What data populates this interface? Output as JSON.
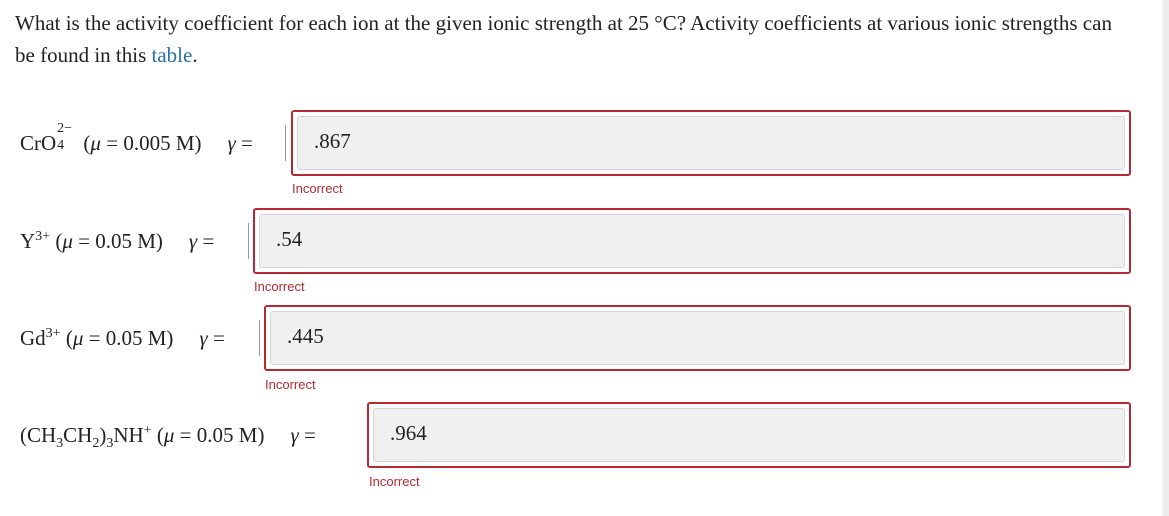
{
  "question": {
    "text": "What is the activity coefficient for each ion at the given ionic strength at 25 °C? Activity coefficients at various ionic strengths can be found in this ",
    "link": "table",
    "end": "."
  },
  "rows": [
    {
      "ion": "CrO",
      "ion_sub": "4",
      "ion_charge": "2−",
      "mu_label": "μ",
      "strength": "0.005 M",
      "gamma_label": "γ",
      "value": ".867",
      "status": "Incorrect"
    },
    {
      "ion": "Y",
      "ion_charge": "3+",
      "mu_label": "μ",
      "strength": "0.05 M",
      "gamma_label": "γ",
      "value": ".54",
      "status": "Incorrect"
    },
    {
      "ion": "Gd",
      "ion_charge": "3+",
      "mu_label": "μ",
      "strength": "0.05 M",
      "gamma_label": "γ",
      "value": ".445",
      "status": "Incorrect"
    },
    {
      "ion_parts": [
        "(CH",
        "3",
        "CH",
        "2",
        ")",
        "3",
        "NH"
      ],
      "ion_charge": "+",
      "mu_label": "μ",
      "strength": "0.05 M",
      "gamma_label": "γ",
      "value": ".964",
      "status": "Incorrect"
    }
  ],
  "colors": {
    "error": "#b32a35",
    "link": "#2a6ea6",
    "field_bg": "#f0f0f0"
  }
}
